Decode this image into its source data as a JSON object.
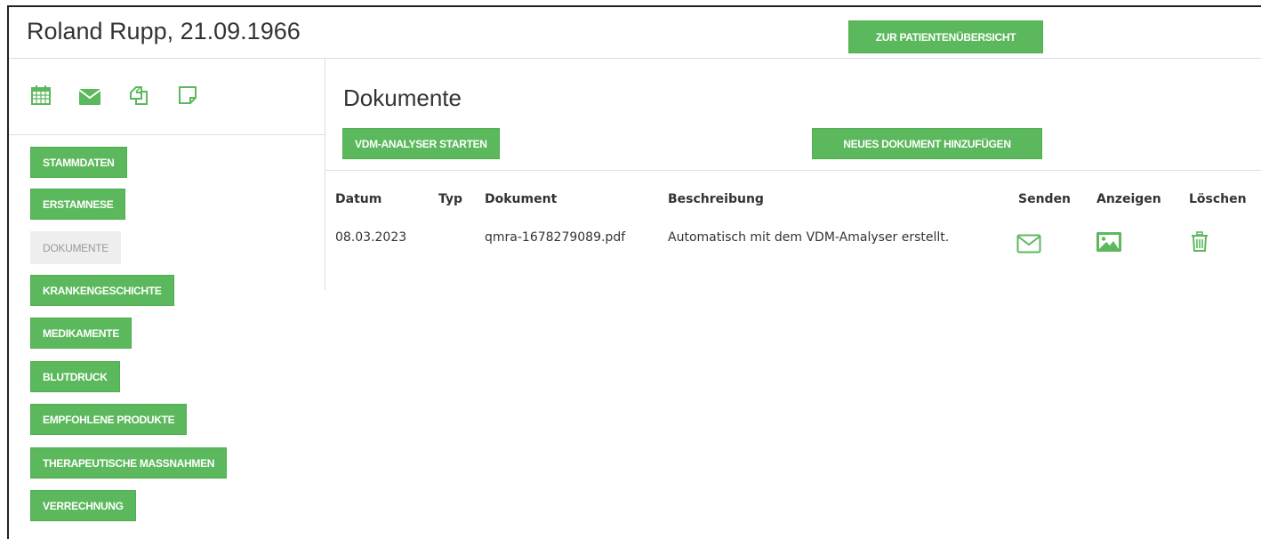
{
  "header": {
    "patient": "Roland Rupp, 21.09.1966",
    "overview_button": "ZUR PATIENTENÜBERSICHT"
  },
  "sidebar": {
    "icons": [
      "calendar-icon",
      "envelope-icon",
      "copy-icon",
      "note-icon"
    ],
    "items": [
      {
        "label": "STAMMDATEN"
      },
      {
        "label": "ERSTAMNESE"
      },
      {
        "label": "DOKUMENTE",
        "active": true
      },
      {
        "label": "KRANKENGESCHICHTE"
      },
      {
        "label": "MEDIKAMENTE"
      },
      {
        "label": "BLUTDRUCK"
      },
      {
        "label": "EMPFOHLENE PRODUKTE"
      },
      {
        "label": "THERAPEUTISCHE MASSNAHMEN"
      },
      {
        "label": "VERRECHNUNG"
      }
    ]
  },
  "main": {
    "title": "Dokumente",
    "analyser_button": "VDM-ANALYSER STARTEN",
    "add_button": "NEUES DOKUMENT HINZUFÜGEN",
    "table": {
      "headers": [
        "Datum",
        "Typ",
        "Dokument",
        "Beschreibung",
        "Senden",
        "Anzeigen",
        "Löschen"
      ],
      "rows": [
        {
          "datum": "08.03.2023",
          "typ": "",
          "dokument": "qmra-1678279089.pdf",
          "beschreibung": "Automatisch mit dem VDM-Amalyser erstellt."
        }
      ]
    }
  },
  "colors": {
    "accent": "#5cb85c",
    "inactive_bg": "#eeeeee",
    "divider": "#dddddd"
  }
}
